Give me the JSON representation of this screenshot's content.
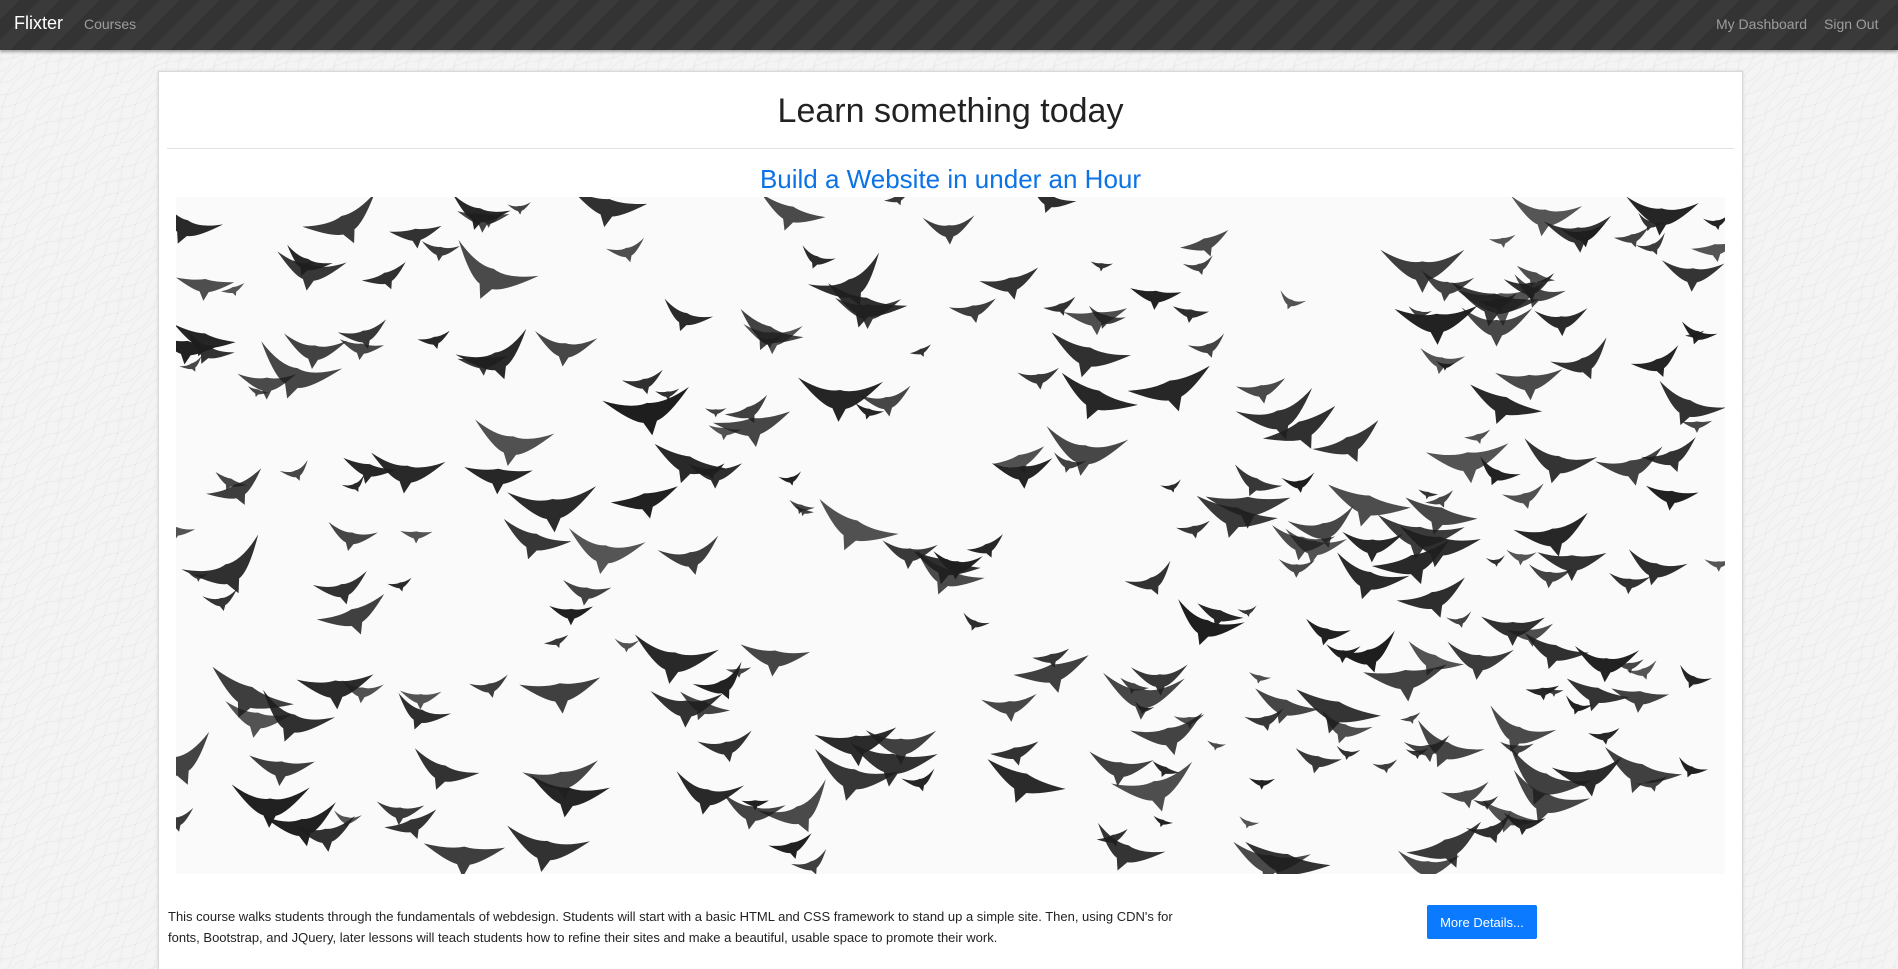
{
  "navbar": {
    "brand": "Flixter",
    "courses_label": "Courses",
    "dashboard_label": "My Dashboard",
    "signout_label": "Sign Out"
  },
  "main": {
    "heading": "Learn something today",
    "course": {
      "title": "Build a Website in under an Hour",
      "image_icon": "birds-flock-photo",
      "description": "This course walks students through the fundamentals of webdesign. Students will start with a basic HTML and CSS framework to stand up a simple site. Then, using CDN's for fonts, Bootstrap, and JQuery, later lessons will teach students how to refine their sites and make a beautiful, usable space to promote their work.",
      "button_label": "More Details..."
    }
  },
  "colors": {
    "navbar_bg": "#353535",
    "brand_text": "#ffffff",
    "nav_link_text": "#9d9d9d",
    "link_blue": "#0b73e5",
    "button_blue": "#0b7aff",
    "page_bg": "#f4f4f4",
    "card_bg": "#ffffff"
  }
}
